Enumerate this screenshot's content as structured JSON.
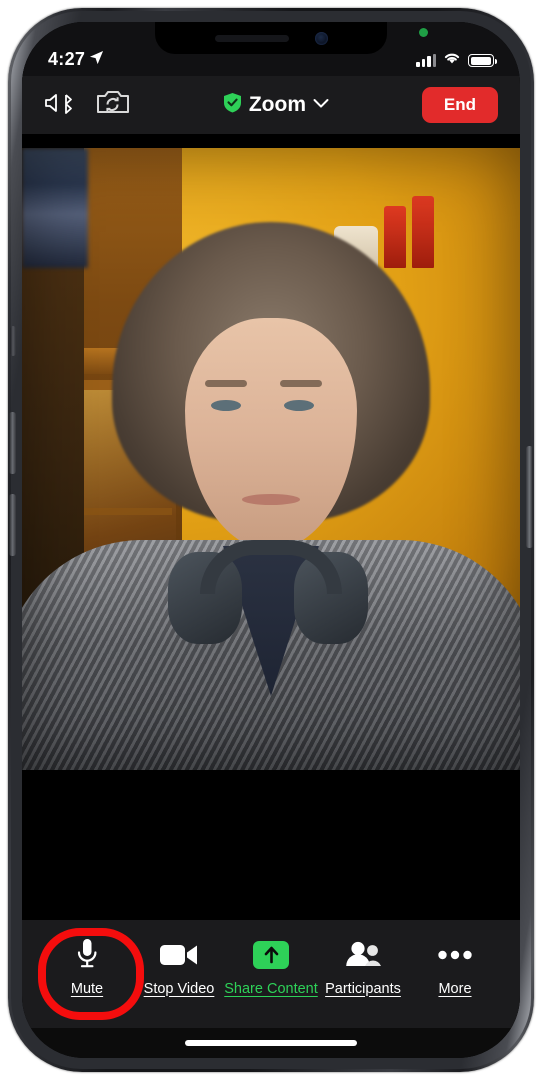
{
  "status_bar": {
    "time": "4:27",
    "location_icon": "location-arrow-icon",
    "signal_icon": "cellular-bars-icon",
    "wifi_icon": "wifi-icon",
    "battery_icon": "battery-icon",
    "camera_active_indicator": "green-camera-dot"
  },
  "nav_bar": {
    "speaker_icon": "speaker-bluetooth-icon",
    "flip_camera_icon": "switch-camera-icon",
    "shield_icon": "encryption-shield-icon",
    "title": "Zoom",
    "chevron_icon": "chevron-down-icon",
    "end_label": "End"
  },
  "video": {
    "description": "self-view video of a person with curly hair, headphones around neck, gray knit cardigan, orange wall and wooden cabinet"
  },
  "toolbar": {
    "items": [
      {
        "label": "Mute",
        "icon": "microphone-icon",
        "highlighted": true,
        "color": "#ffffff"
      },
      {
        "label": "Stop Video",
        "icon": "video-camera-icon",
        "highlighted": false,
        "color": "#ffffff"
      },
      {
        "label": "Share Content",
        "icon": "share-up-arrow-icon",
        "highlighted": false,
        "color": "#2ed158"
      },
      {
        "label": "Participants",
        "icon": "people-icon",
        "highlighted": false,
        "color": "#ffffff"
      },
      {
        "label": "More",
        "icon": "ellipsis-icon",
        "highlighted": false,
        "color": "#ffffff"
      }
    ]
  },
  "annotation": {
    "shape": "red-rounded-rect-highlight",
    "target": "Mute",
    "color": "#f40d0d"
  },
  "home_indicator": {
    "name": "home-indicator-bar"
  },
  "colors": {
    "end_button": "#e22b2b",
    "share_green": "#2ed158",
    "chrome_bg": "#1b1b1d",
    "annotation_red": "#f40d0d"
  }
}
